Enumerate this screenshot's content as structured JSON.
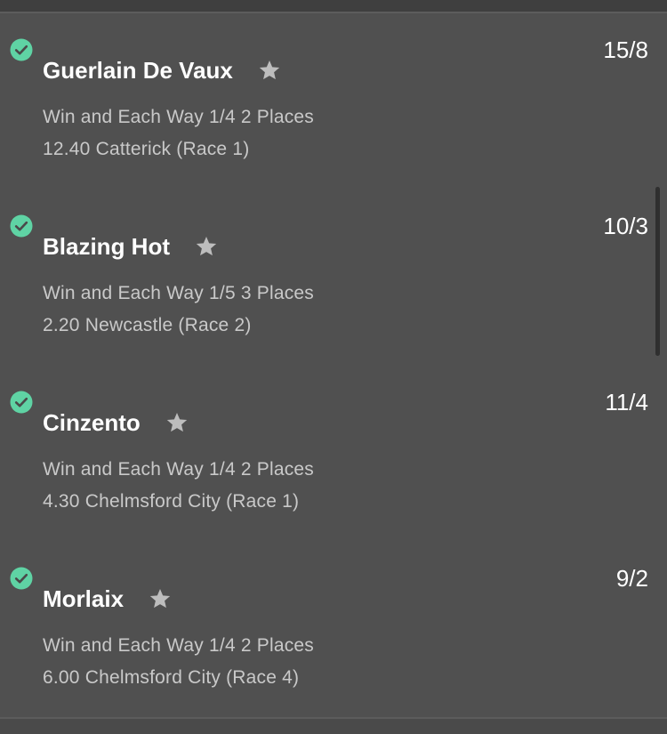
{
  "colors": {
    "background": "#505050",
    "check": "#5fd3a4",
    "star": "#bdbdbd",
    "primary_text": "#ffffff",
    "secondary_text": "#c9c9c9"
  },
  "selections": [
    {
      "name": "Guerlain De Vaux",
      "odds": "15/8",
      "market": "Win and Each Way 1/4 2 Places",
      "race": "12.40 Catterick (Race 1)",
      "status_icon": "check-circle-icon",
      "favourite_icon": "star-icon"
    },
    {
      "name": "Blazing Hot",
      "odds": "10/3",
      "market": "Win and Each Way 1/5 3 Places",
      "race": "2.20 Newcastle (Race 2)",
      "status_icon": "check-circle-icon",
      "favourite_icon": "star-icon"
    },
    {
      "name": "Cinzento",
      "odds": "11/4",
      "market": "Win and Each Way 1/4 2 Places",
      "race": "4.30 Chelmsford City (Race 1)",
      "status_icon": "check-circle-icon",
      "favourite_icon": "star-icon"
    },
    {
      "name": "Morlaix",
      "odds": "9/2",
      "market": "Win and Each Way 1/4 2 Places",
      "race": "6.00 Chelmsford City (Race 4)",
      "status_icon": "check-circle-icon",
      "favourite_icon": "star-icon"
    }
  ]
}
